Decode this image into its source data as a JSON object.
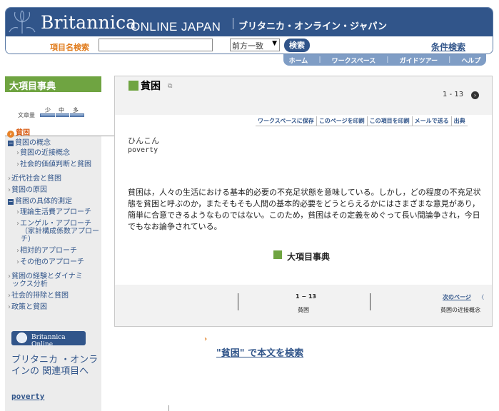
{
  "header": {
    "brand": "Britannica",
    "edition": "ONLINE JAPAN",
    "brand_jp": "ブリタニカ・オンライン・ジャパン",
    "search_label": "項目名検索",
    "search_value": "",
    "search_mode": "前方一致",
    "search_button": "検索",
    "advanced_search": "条件検索"
  },
  "nav": {
    "home": "ホーム",
    "workspace": "ワークスペース",
    "guide": "ガイドツアー",
    "help": "ヘルプ",
    "separator": "|"
  },
  "sidebar": {
    "title": "大項目事典",
    "size_label": "文章量",
    "size_options": [
      "少",
      "中",
      "多"
    ],
    "current": "貧困",
    "toc": [
      {
        "label": "貧困の概念",
        "type": "section"
      },
      {
        "label": "貧困の近接概念",
        "type": "sub"
      },
      {
        "label": "社会的価値判断と貧困",
        "type": "sub"
      },
      {
        "label": "近代社会と貧困",
        "type": "item"
      },
      {
        "label": "貧困の原因",
        "type": "item"
      },
      {
        "label": "貧困の具体的測定",
        "type": "section"
      },
      {
        "label": "理論生活費アプローチ",
        "type": "sub"
      },
      {
        "label": "エンゲル・アプローチ",
        "type": "sub"
      },
      {
        "label": "（家計構成係数アプロー",
        "type": "cont"
      },
      {
        "label": "チ）",
        "type": "cont"
      },
      {
        "label": "相対的アプローチ",
        "type": "sub"
      },
      {
        "label": "その他のアプローチ",
        "type": "sub"
      },
      {
        "label": "貧困の経験とダイナミ",
        "type": "item"
      },
      {
        "label": "ックス分析",
        "type": "cont0"
      },
      {
        "label": "社会的排除と貧困",
        "type": "item"
      },
      {
        "label": "政策と貧困",
        "type": "item"
      }
    ],
    "promo_logo": "Britannica Online",
    "promo_text": "ブリタニカ ・オンラインの 関連項目へ",
    "promo_link": "poverty"
  },
  "article": {
    "title": "貧困",
    "page_range": "1 - 13",
    "tools": [
      "ワークスペースに保存",
      "このページを印刷",
      "この項目を印刷",
      "メールで送る",
      "出典"
    ],
    "reading": "ひんこん",
    "reading_en": "poverty",
    "body": "貧困は，人々の生活における基本的必要の不充足状態を意味している。しかし，どの程度の不充足状態を貧困と呼ぶのか，またそもそも人間の基本的必要をどうとらえるかにはさまざまな意見があり，簡単に合意できるようなものではない。このため，貧困はその定義をめぐって長い間論争され，今日でもなお論争されている。",
    "section_label": "大項目事典"
  },
  "pager": {
    "range": "1 − 13",
    "current": "貧困",
    "next_label": "次のページ",
    "next_arrow": "〈",
    "next_title": "貧困の近接概念"
  },
  "footer": {
    "search_arrow": "›",
    "search_body": "\"貧困\" で本文を検索"
  },
  "colors": {
    "header_blue": "#31558a",
    "accent_green": "#6fa441",
    "accent_orange": "#e07a1a"
  }
}
